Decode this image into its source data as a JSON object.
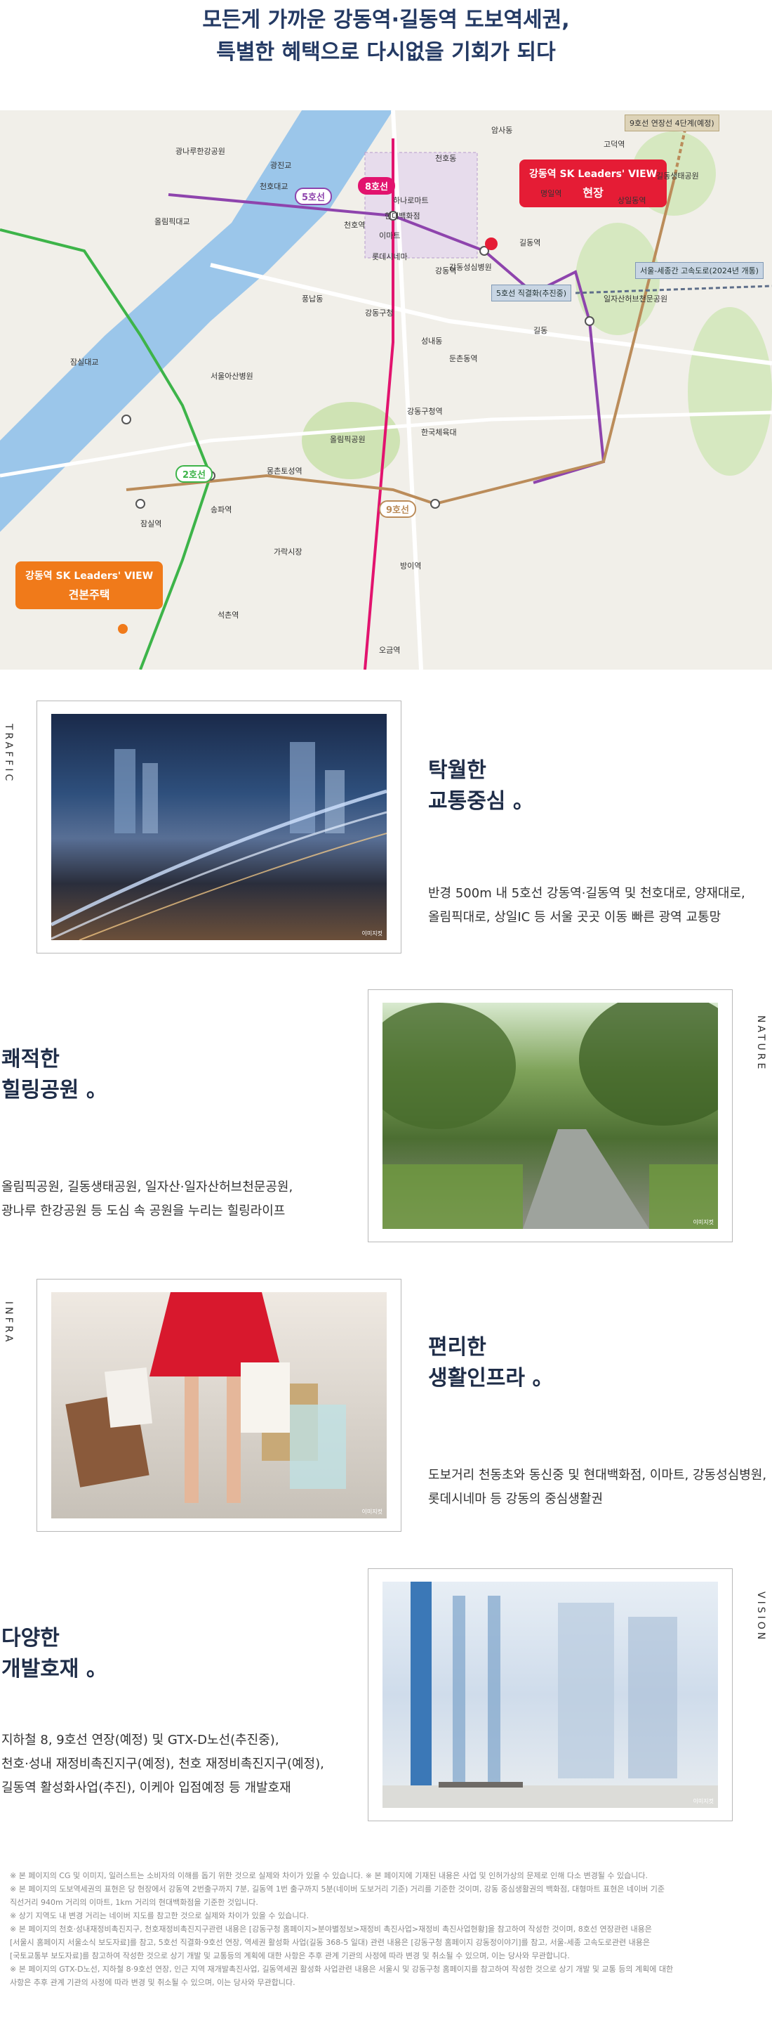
{
  "headline": {
    "line1": "모든게 가까운 강동역·길동역 도보역세권,",
    "line2": "특별한 혜택으로 다시없을 기회가 되다"
  },
  "map": {
    "site_bubble": {
      "brand": "강동역 SK Leaders' VIEW",
      "label": "현장"
    },
    "showroom_bubble": {
      "brand": "강동역 SK Leaders' VIEW",
      "label": "견본주택"
    },
    "line_tags": [
      "5호선",
      "8호선",
      "2호선",
      "9호선"
    ],
    "extension_tag": "9호선 연장선 4단계(예정)",
    "expressway_tag": "서울-세종간 고속도로(2024년 개통)",
    "direct_tag": "5호선 직결화(추진중)",
    "labels": [
      "현대백화점",
      "이마트",
      "강동성심병원",
      "강동구청",
      "천호역",
      "강동역",
      "길동역",
      "둔촌동역",
      "명일역",
      "고덕역",
      "상일동역",
      "천호동",
      "성내동",
      "길동",
      "광나루한강공원",
      "올림픽공원",
      "일자산허브천문공원",
      "길동생태공원",
      "잠실역",
      "석촌역",
      "송파역",
      "가락시장",
      "오금역",
      "방이역",
      "몽촌토성역",
      "강동구청역",
      "하나로마트",
      "롯데시네마",
      "암사동",
      "풍납동",
      "광진교",
      "천호대교",
      "올림픽대교",
      "잠실대교",
      "서울아산병원",
      "한국체육대"
    ]
  },
  "sections": [
    {
      "side": "TRAFFIC",
      "title_l1": "탁월한",
      "title_l2": "교통중심 。",
      "desc_l1": "반경 500m 내 5호선 강동역·길동역 및 천호대로, 양재대로,",
      "desc_l2": "올림픽대로, 상일IC 등 서울 곳곳 이동 빠른 광역 교통망",
      "caption": "이미지컷"
    },
    {
      "side": "NATURE",
      "title_l1": "쾌적한",
      "title_l2": "힐링공원 。",
      "desc_l1": "올림픽공원, 길동생태공원, 일자산·일자산허브천문공원,",
      "desc_l2": "광나루 한강공원 등 도심 속 공원을 누리는 힐링라이프",
      "caption": "이미지컷"
    },
    {
      "side": "INFRA",
      "title_l1": "편리한",
      "title_l2": "생활인프라 。",
      "desc_l1": "도보거리 천동초와 동신중 및 현대백화점, 이마트, 강동성심병원,",
      "desc_l2": "롯데시네마 등 강동의 중심생활권",
      "caption": "이미지컷"
    },
    {
      "side": "VISION",
      "title_l1": "다양한",
      "title_l2": "개발호재 。",
      "desc_l1": "지하철 8, 9호선 연장(예정) 및 GTX-D노선(추진중),",
      "desc_l2": "천호·성내 재정비촉진지구(예정), 천호 재정비촉진지구(예정),",
      "desc_l3": "길동역 활성화사업(추진), 이케아 입점예정 등 개발호재",
      "caption": "이미지컷"
    }
  ],
  "notes": [
    "※ 본 페이지의 CG 및 이미지, 일러스트는 소비자의 이해를 돕기 위한 것으로 실제와 차이가 있을 수 있습니다.  ※ 본 페이지에 기재된 내용은 사업 및 인허가상의 문제로 인해 다소 변경될 수 있습니다.",
    "※ 본 페이지의 도보역세권의 표현은 당 현장에서 강동역 2번출구까지 7분, 길동역 1번 출구까지 5분(네이버 도보거리 기준) 거리를 기준한 것이며, 강동 중심생활권의 백화점, 대형마트 표현은 네이버 기준",
    "   직선거리 940m 거리의 이마트, 1km 거리의 현대백화점을 기준한 것입니다.",
    "※ 상기 지역도 내 변경 거리는 네이버 지도를 참고한 것으로 실제와 차이가 있을 수 있습니다.",
    "※ 본 페이지의 천호·성내재정비촉진지구, 천호재정비촉진지구관련 내용은 [강동구청 홈페이지>분야별정보>재정비 촉진사업>재정비 촉진사업현황]을 참고하여 작성한 것이며, 8호선 연장관련 내용은",
    "   [서울시 홈페이지 서울소식 보도자료]를 참고, 5호선 직결화·9호선 연장, 역세권 활성화 사업(길동 368-5 일대) 관련 내용은 [강동구청 홈페이지 강동정이야기]를 참고, 서울-세종 고속도로관련 내용은",
    "   [국토교통부 보도자료]를 참고하여 작성한 것으로 상기 개발 및 교통등의 계획에 대한 사항은 추후 관계 기관의 사정에 따라 변경 및 취소될 수 있으며, 이는 당사와 무관합니다.",
    "※ 본 페이지의 GTX-D노선, 지하철 8·9호선 연장, 인근 지역 재개발촉진사업, 길동역세권 활성화 사업관련 내용은 서울시 및 강동구청 홈페이지를 참고하여 작성한 것으로 상기 개발 및 교통 등의 계획에 대한",
    "   사항은 추후 관계 기관의 사정에 따라 변경 및 취소될 수 있으며, 이는 당사와 무관합니다."
  ]
}
